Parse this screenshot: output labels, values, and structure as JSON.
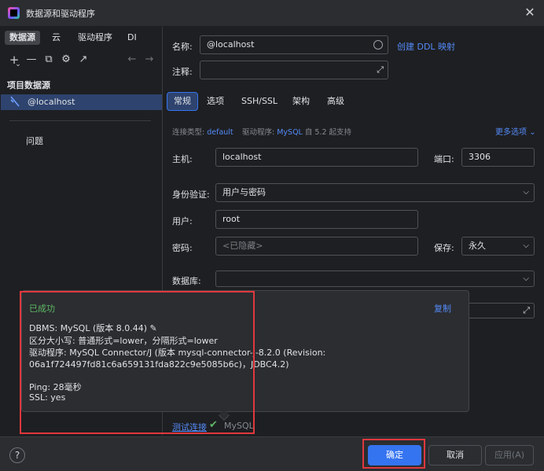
{
  "window": {
    "title": "数据源和驱动程序",
    "close": "✕"
  },
  "sidebar": {
    "tabs": [
      "数据源",
      "云",
      "驱动程序",
      "DI"
    ],
    "toolbar": {
      "add": "+",
      "add_chev": "⌄",
      "remove": "—",
      "copy": "⧉",
      "settings": "⚙",
      "export": "↗",
      "back": "←",
      "forward": "→"
    },
    "section_title": "项目数据源",
    "datasource": "@localhost",
    "problems": "问题"
  },
  "form": {
    "name_label": "名称:",
    "name_value": "@localhost",
    "create_ddl": "创建 DDL 映射",
    "comment_label": "注释:",
    "tabs": [
      "常规",
      "选项",
      "SSH/SSL",
      "架构",
      "高级"
    ],
    "conn_type_label": "连接类型:",
    "conn_type_value": "default",
    "driver_label": "驱动程序:",
    "driver_value": "MySQL",
    "driver_note": "自 5.2 起支持",
    "more_options": "更多选项",
    "host_label": "主机:",
    "host_value": "localhost",
    "port_label": "端口:",
    "port_value": "3306",
    "auth_label": "身份验证:",
    "auth_value": "用户与密码",
    "user_label": "用户:",
    "user_value": "root",
    "password_label": "密码:",
    "password_placeholder": "<已隐藏>",
    "save_label": "保存:",
    "save_value": "永久",
    "database_label": "数据库:"
  },
  "popup": {
    "status": "已成功",
    "copy": "复制",
    "lines": [
      "DBMS: MySQL (版本 8.0.44)",
      "区分大小写: 普通形式=lower，分隔形式=lower",
      "驱动程序: MySQL Connector/J (版本 mysql-connector-j-8.2.0 (Revision:",
      "06a1f724497fd81c6a659131fda822c9e5085b6c)，JDBC4.2)",
      "Ping: 28毫秒",
      "SSL: yes"
    ]
  },
  "test": {
    "link": "测试连接",
    "check": "✔",
    "driver": "MySQL"
  },
  "footer": {
    "help": "?",
    "ok": "确定",
    "cancel": "取消",
    "apply": "应用(A)"
  },
  "icons": {
    "datasource": "database-connection-icon",
    "pencil": "pencil-icon",
    "expand": "expand-icon",
    "chevron": "chevron-down-icon"
  },
  "colors": {
    "accent": "#3574f0",
    "success": "#5fb865",
    "highlight": "#e0383e",
    "link": "#548af7"
  }
}
